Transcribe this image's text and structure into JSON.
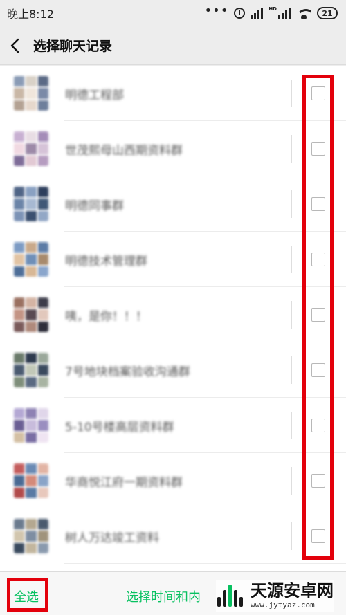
{
  "status_bar": {
    "time": "晚上8:12",
    "dots": "•••",
    "network_badge": "HD",
    "battery": "21"
  },
  "header": {
    "title": "选择聊天记录",
    "back_icon": "chevron-left-icon"
  },
  "chats": [
    {
      "name": "明德工程部",
      "avatar_colors": [
        "#8a9bb5",
        "#d9d2c8",
        "#5b6a86",
        "#c9b7a6",
        "#f0e6dc",
        "#7b8aa8",
        "#b4a293",
        "#e6d8cc",
        "#6e7f9c"
      ]
    },
    {
      "name": "世茂熙母山西期资料群",
      "avatar_colors": [
        "#c8b0d2",
        "#e8dde4",
        "#a48cb8",
        "#f1d9e2",
        "#9d8aa8",
        "#d6c3d8",
        "#7e6c98",
        "#e2c9d4",
        "#b69cc0"
      ]
    },
    {
      "name": "明德同事群",
      "avatar_colors": [
        "#4f6486",
        "#8aa1c2",
        "#2d3e5c",
        "#6b84a8",
        "#a7b9d2",
        "#405877",
        "#7c93b6",
        "#3b5070",
        "#92a7c6"
      ]
    },
    {
      "name": "明德技术管理群",
      "avatar_colors": [
        "#7d9bc4",
        "#c9a98a",
        "#5b7ba6",
        "#e2c4a4",
        "#6f8fb8",
        "#a88a6c",
        "#4e6e98",
        "#d8b896",
        "#8aa6cc"
      ]
    },
    {
      "name": "咦，是你！！！",
      "avatar_colors": [
        "#9a7060",
        "#d4b4a4",
        "#3c3c4a",
        "#c49484",
        "#5a4a52",
        "#e2c8bc",
        "#7a5a5a",
        "#b08a7c",
        "#2e2e3a"
      ]
    },
    {
      "name": "7号地块档案验收沟通群",
      "avatar_colors": [
        "#6a7a6a",
        "#2e3a4e",
        "#9aa89a",
        "#4a5a70",
        "#c2c8b8",
        "#3a4a5e",
        "#7e8e7a",
        "#5a6a82",
        "#a8b4a2"
      ]
    },
    {
      "name": "5-10号楼高层资料群",
      "avatar_colors": [
        "#b4a8d4",
        "#8e82b4",
        "#e0d6ea",
        "#6a5e94",
        "#c8bcdc",
        "#9a8ec0",
        "#d4c0a4",
        "#7a6ea4",
        "#efe4f2"
      ]
    },
    {
      "name": "华商悦江府一期资料群",
      "avatar_colors": [
        "#c45c5c",
        "#6a8ab4",
        "#e2b4a4",
        "#4a6a94",
        "#d48a7a",
        "#8aa4c8",
        "#b24a4a",
        "#5a7aa4",
        "#e8c8bc"
      ]
    },
    {
      "name": "树人万达竣工资料",
      "avatar_colors": [
        "#6a7a8e",
        "#b4a890",
        "#4a5a6e",
        "#d2c6ae",
        "#7e8ea2",
        "#a0947c",
        "#3a4a5e",
        "#c2b69e",
        "#8a9aae"
      ]
    }
  ],
  "bottom_bar": {
    "select_all": "全选",
    "select_by_time": "选择时间和内"
  },
  "watermark": {
    "main": "天源安卓网",
    "url": "www.jytyaz.com"
  },
  "colors": {
    "accent": "#07c160",
    "highlight": "#e3000b",
    "background": "#ededed"
  }
}
